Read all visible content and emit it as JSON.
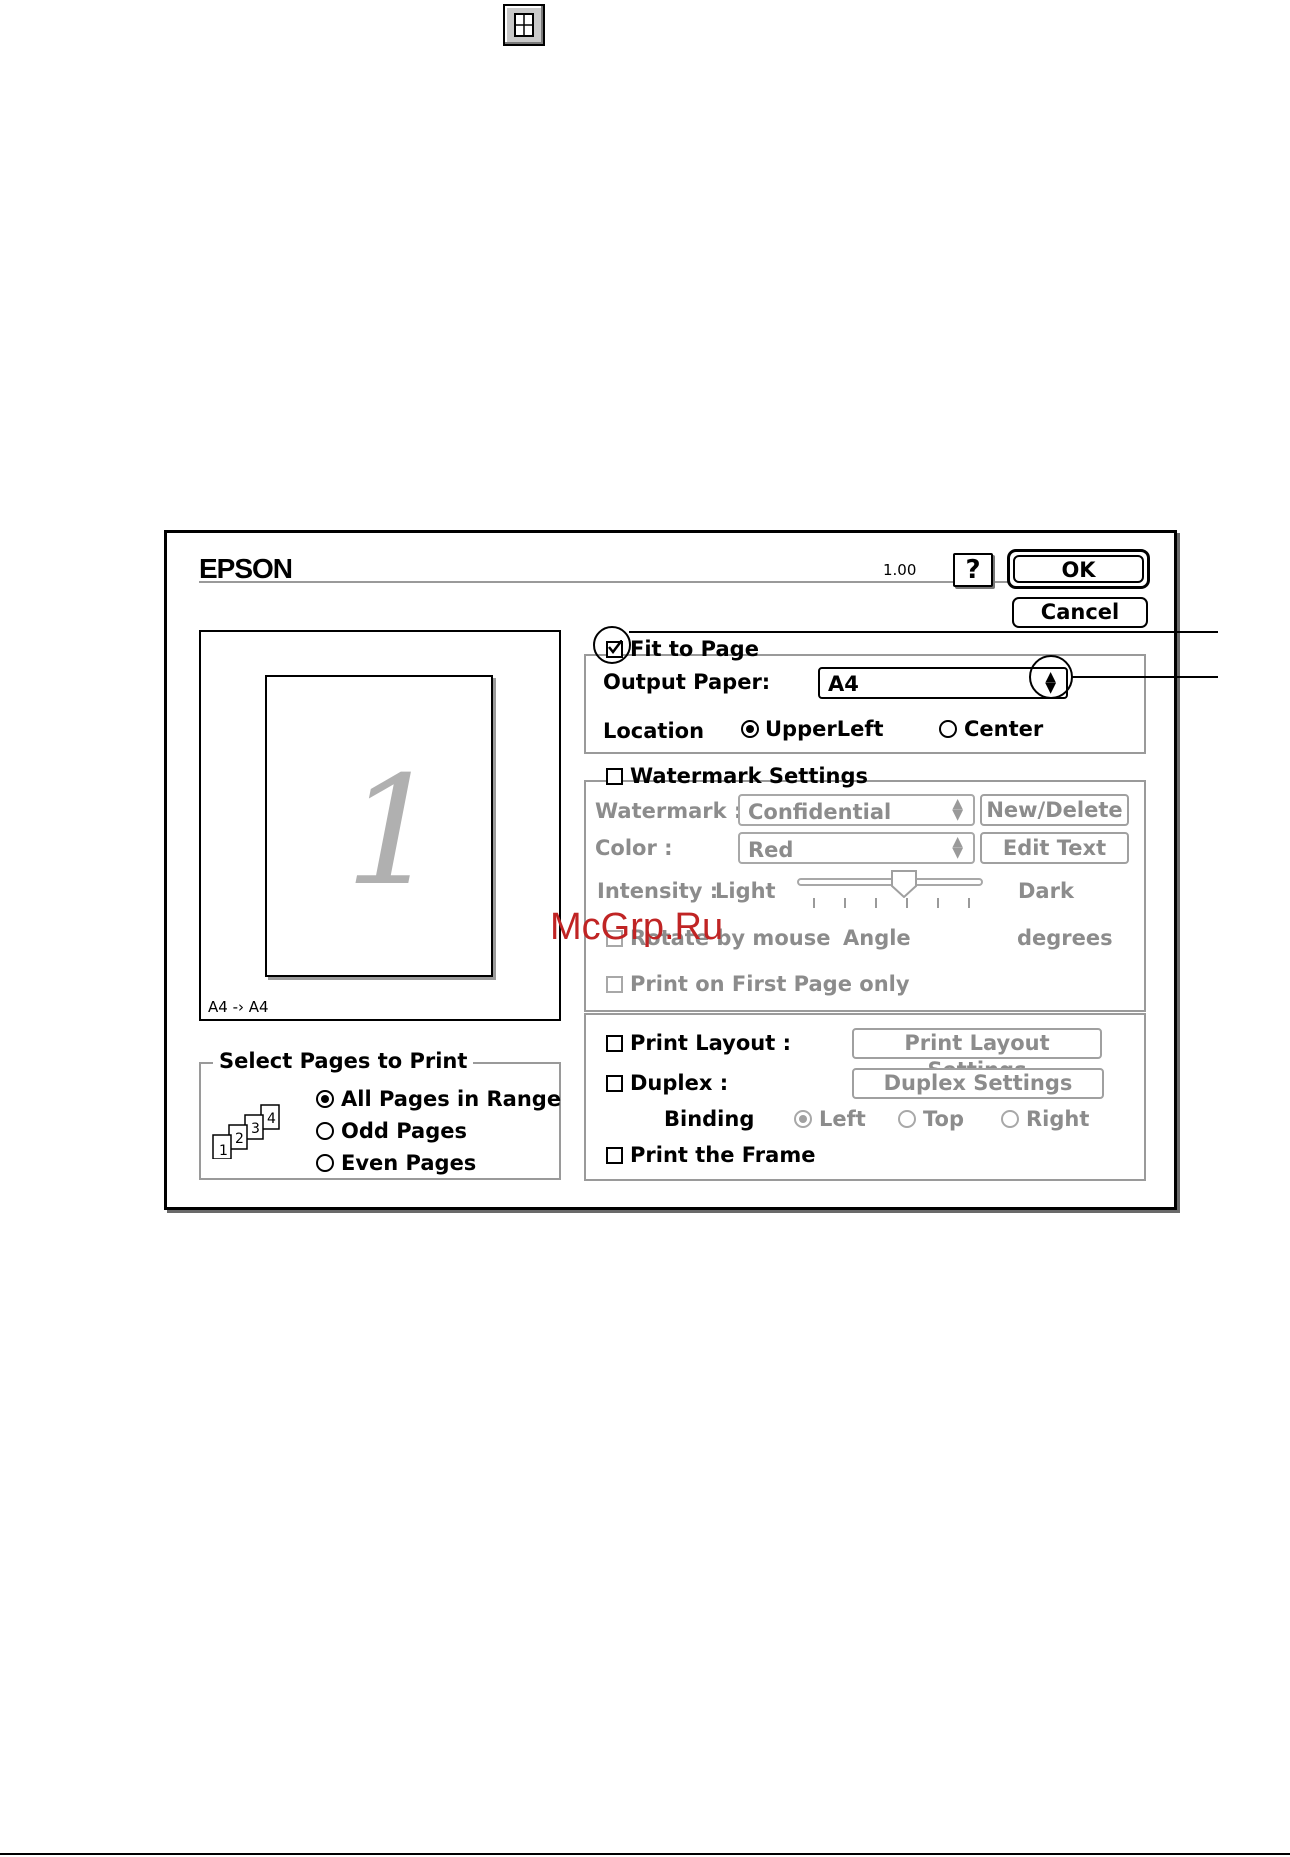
{
  "dialog": {
    "brand": "EPSON",
    "version": "1.00",
    "help_label": "?",
    "ok_label": "OK",
    "cancel_label": "Cancel"
  },
  "preview": {
    "page_number": "1",
    "size_caption": "A4 -› A4"
  },
  "fit_to_page": {
    "label": "Fit to Page",
    "checked": true,
    "output_paper_label": "Output Paper:",
    "output_paper_value": "A4",
    "location_label": "Location",
    "location_options": [
      "UpperLeft",
      "Center"
    ],
    "location_selected": "UpperLeft"
  },
  "watermark": {
    "label": "Watermark Settings",
    "watermark_label": "Watermark :",
    "watermark_value": "Confidential",
    "new_delete_label": "New/Delete",
    "color_label": "Color :",
    "color_value": "Red",
    "edit_text_label": "Edit Text",
    "intensity_label": "Intensity :",
    "light_label": "Light",
    "dark_label": "Dark",
    "intensity_level": 0.6,
    "rotate_label": "Rotate by mouse",
    "angle_label": "Angle",
    "degrees_label": "degrees",
    "first_page_label": "Print on First Page only"
  },
  "layout": {
    "print_layout_label": "Print Layout :",
    "print_layout_settings_label": "Print Layout Settings",
    "duplex_label": "Duplex :",
    "duplex_settings_label": "Duplex Settings",
    "binding_label": "Binding",
    "binding_options": [
      "Left",
      "Top",
      "Right"
    ],
    "binding_selected": "Left",
    "print_frame_label": "Print the Frame"
  },
  "select_pages": {
    "title": "Select Pages to Print",
    "options": [
      "All Pages in Range",
      "Odd Pages",
      "Even Pages"
    ],
    "selected": "All Pages in Range",
    "icon_pages": [
      "1",
      "2",
      "3",
      "4"
    ]
  },
  "watermark_overlay": "McGrp.Ru"
}
